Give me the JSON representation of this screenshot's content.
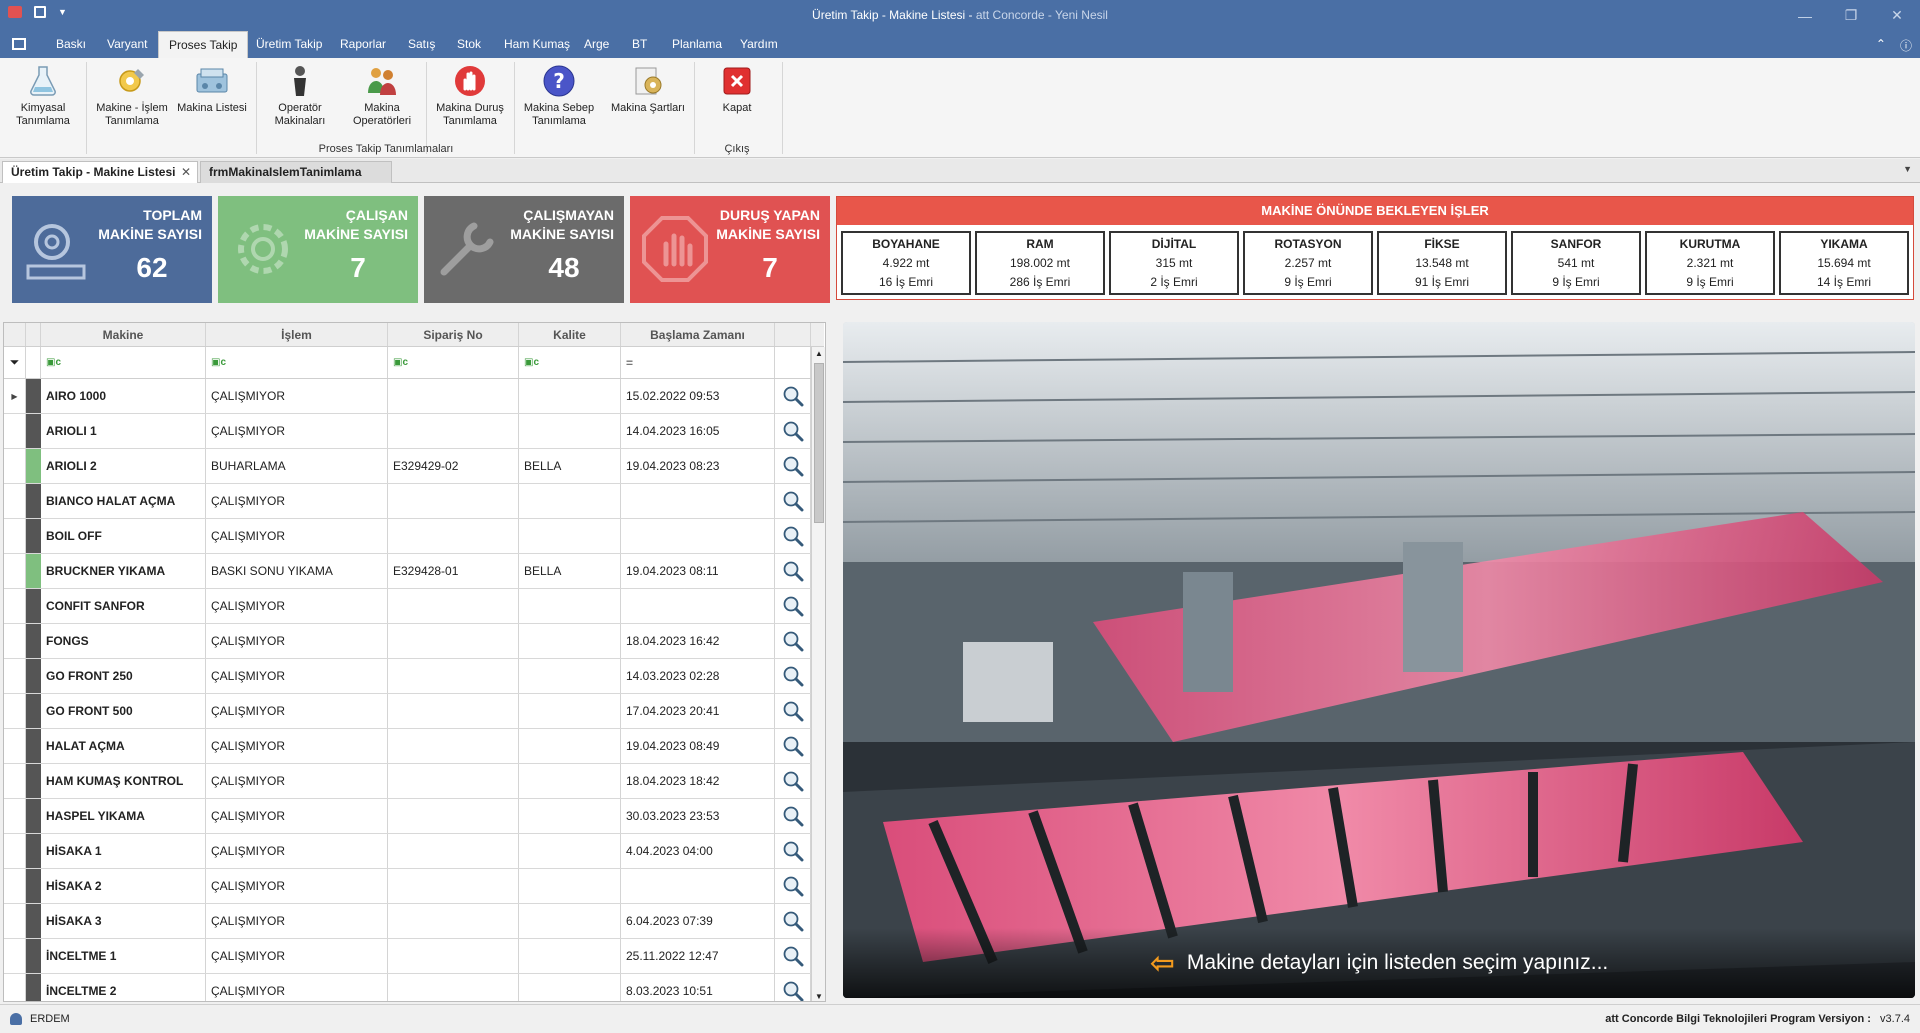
{
  "window": {
    "title_main": "Üretim Takip - Makine Listesi - ",
    "title_sub": "att Concorde - Yeni Nesil"
  },
  "menu": [
    "Baskı",
    "Varyant",
    "Proses Takip",
    "Üretim Takip",
    "Raporlar",
    "Satış",
    "Stok",
    "Ham Kumaş",
    "Arge",
    "BT",
    "Planlama",
    "Yardım"
  ],
  "ribbon": {
    "buttons": [
      {
        "label": "Kimyasal Tanımlama",
        "icon": "chemical-icon"
      },
      {
        "label": "Makine - İşlem Tanımlama",
        "icon": "machine-process-icon"
      },
      {
        "label": "Makina Listesi",
        "icon": "machine-list-icon"
      },
      {
        "label": "Operatör Makinaları",
        "icon": "operator-icon"
      },
      {
        "label": "Makina Operatörleri",
        "icon": "operators-group-icon"
      },
      {
        "label": "Makina Duruş Tanımlama",
        "icon": "stop-hand-icon"
      },
      {
        "label": "Makina Sebep Tanımlama",
        "icon": "question-icon"
      },
      {
        "label": "Makina Şartları",
        "icon": "conditions-icon"
      },
      {
        "label": "Kapat",
        "icon": "close-icon"
      }
    ],
    "group_main": "Proses Takip Tanımlamaları",
    "group_exit": "Çıkış"
  },
  "doc_tabs": [
    "Üretim Takip - Makine Listesi",
    "frmMakinaIslemTanimlama"
  ],
  "kpis": [
    {
      "label1": "TOPLAM",
      "label2": "MAKİNE SAYISI",
      "value": "62",
      "color": "#4d6b9a"
    },
    {
      "label1": "ÇALIŞAN",
      "label2": "MAKİNE SAYISI",
      "value": "7",
      "color": "#7fbf7f"
    },
    {
      "label1": "ÇALIŞMAYAN",
      "label2": "MAKİNE SAYISI",
      "value": "48",
      "color": "#6b6b6b"
    },
    {
      "label1": "DURUŞ YAPAN",
      "label2": "MAKİNE SAYISI",
      "value": "7",
      "color": "#e05252"
    }
  ],
  "waiting": {
    "title": "MAKİNE ÖNÜNDE BEKLEYEN İŞLER",
    "items": [
      {
        "name": "BOYAHANE",
        "meters": "4.922 mt",
        "orders": "16 İş Emri"
      },
      {
        "name": "RAM",
        "meters": "198.002 mt",
        "orders": "286 İş Emri"
      },
      {
        "name": "DİJİTAL",
        "meters": "315 mt",
        "orders": "2 İş Emri"
      },
      {
        "name": "ROTASYON",
        "meters": "2.257 mt",
        "orders": "9 İş Emri"
      },
      {
        "name": "FİKSE",
        "meters": "13.548 mt",
        "orders": "91 İş Emri"
      },
      {
        "name": "SANFOR",
        "meters": "541 mt",
        "orders": "9 İş Emri"
      },
      {
        "name": "KURUTMA",
        "meters": "2.321 mt",
        "orders": "9 İş Emri"
      },
      {
        "name": "YIKAMA",
        "meters": "15.694 mt",
        "orders": "14 İş Emri"
      }
    ]
  },
  "grid": {
    "columns": [
      "Makine",
      "İşlem",
      "Sipariş No",
      "Kalite",
      "Başlama Zamanı"
    ],
    "rows": [
      {
        "makine": "AIRO 1000",
        "islem": "ÇALIŞMIYOR",
        "siparis": "",
        "kalite": "",
        "baslama": "15.02.2022 09:53",
        "status": "#555555"
      },
      {
        "makine": "ARIOLI 1",
        "islem": "ÇALIŞMIYOR",
        "siparis": "",
        "kalite": "",
        "baslama": "14.04.2023 16:05",
        "status": "#555555"
      },
      {
        "makine": "ARIOLI 2",
        "islem": "BUHARLAMA",
        "siparis": "E329429-02",
        "kalite": "BELLA",
        "baslama": "19.04.2023 08:23",
        "status": "#7fbf7f"
      },
      {
        "makine": "BIANCO HALAT AÇMA",
        "islem": "ÇALIŞMIYOR",
        "siparis": "",
        "kalite": "",
        "baslama": "",
        "status": "#555555"
      },
      {
        "makine": "BOIL OFF",
        "islem": "ÇALIŞMIYOR",
        "siparis": "",
        "kalite": "",
        "baslama": "",
        "status": "#555555"
      },
      {
        "makine": "BRUCKNER YIKAMA",
        "islem": "BASKI SONU YIKAMA",
        "siparis": "E329428-01",
        "kalite": "BELLA",
        "baslama": "19.04.2023 08:11",
        "status": "#7fbf7f"
      },
      {
        "makine": "CONFIT SANFOR",
        "islem": "ÇALIŞMIYOR",
        "siparis": "",
        "kalite": "",
        "baslama": "",
        "status": "#555555"
      },
      {
        "makine": "FONGS",
        "islem": "ÇALIŞMIYOR",
        "siparis": "",
        "kalite": "",
        "baslama": "18.04.2023 16:42",
        "status": "#555555"
      },
      {
        "makine": "GO FRONT 250",
        "islem": "ÇALIŞMIYOR",
        "siparis": "",
        "kalite": "",
        "baslama": "14.03.2023 02:28",
        "status": "#555555"
      },
      {
        "makine": "GO FRONT 500",
        "islem": "ÇALIŞMIYOR",
        "siparis": "",
        "kalite": "",
        "baslama": "17.04.2023 20:41",
        "status": "#555555"
      },
      {
        "makine": "HALAT AÇMA",
        "islem": "ÇALIŞMIYOR",
        "siparis": "",
        "kalite": "",
        "baslama": "19.04.2023 08:49",
        "status": "#555555"
      },
      {
        "makine": "HAM KUMAŞ KONTROL",
        "islem": "ÇALIŞMIYOR",
        "siparis": "",
        "kalite": "",
        "baslama": "18.04.2023 18:42",
        "status": "#555555"
      },
      {
        "makine": "HASPEL YIKAMA",
        "islem": "ÇALIŞMIYOR",
        "siparis": "",
        "kalite": "",
        "baslama": "30.03.2023 23:53",
        "status": "#555555"
      },
      {
        "makine": "HİSAKA 1",
        "islem": "ÇALIŞMIYOR",
        "siparis": "",
        "kalite": "",
        "baslama": "4.04.2023 04:00",
        "status": "#555555"
      },
      {
        "makine": "HİSAKA 2",
        "islem": "ÇALIŞMIYOR",
        "siparis": "",
        "kalite": "",
        "baslama": "",
        "status": "#555555"
      },
      {
        "makine": "HİSAKA 3",
        "islem": "ÇALIŞMIYOR",
        "siparis": "",
        "kalite": "",
        "baslama": "6.04.2023 07:39",
        "status": "#555555"
      },
      {
        "makine": "İNCELTME 1",
        "islem": "ÇALIŞMIYOR",
        "siparis": "",
        "kalite": "",
        "baslama": "25.11.2022 12:47",
        "status": "#555555"
      },
      {
        "makine": "İNCELTME 2",
        "islem": "ÇALIŞMIYOR",
        "siparis": "",
        "kalite": "",
        "baslama": "8.03.2023 10:51",
        "status": "#555555"
      }
    ]
  },
  "photo_caption": "Makine detayları için listeden seçim yapınız...",
  "status": {
    "user": "ERDEM",
    "version_label": "att Concorde Bilgi Teknolojileri Program Versiyon :",
    "version": "v3.7.4"
  }
}
